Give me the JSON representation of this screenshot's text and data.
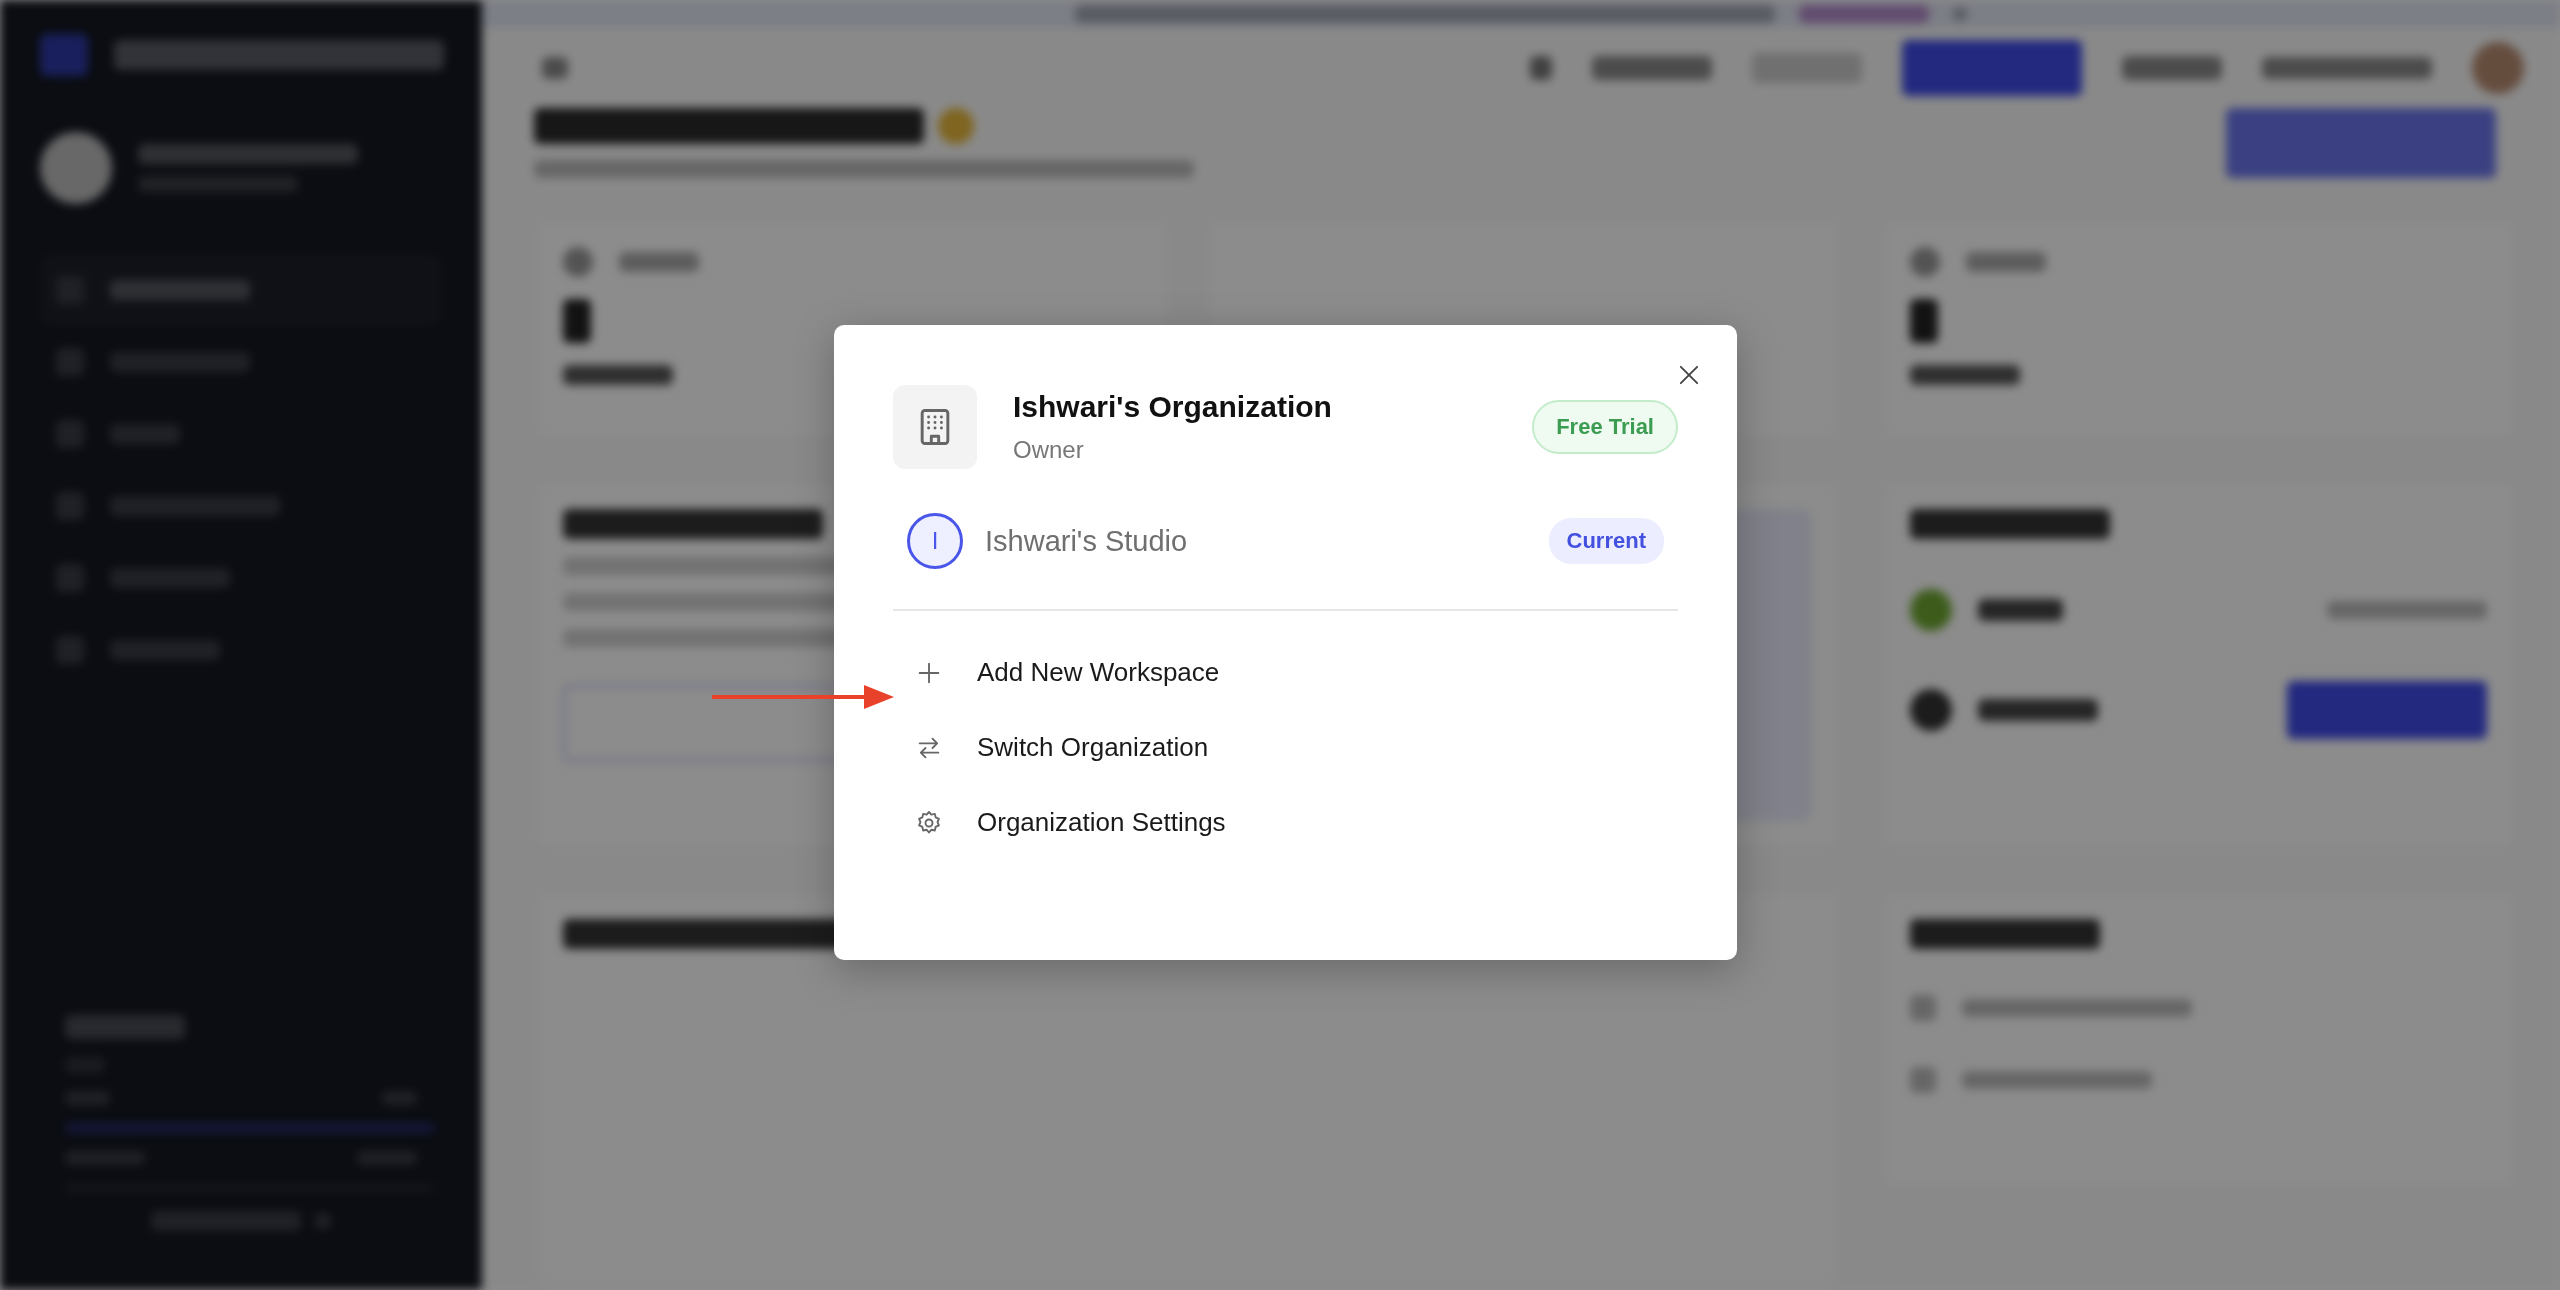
{
  "modal": {
    "org_name": "Ishwari's Organization",
    "role": "Owner",
    "plan_badge": "Free Trial",
    "workspaces": [
      {
        "initial": "I",
        "name": "Ishwari's Studio",
        "badge": "Current",
        "selected": true
      }
    ],
    "actions": [
      {
        "kind": "add",
        "label": "Add New Workspace"
      },
      {
        "kind": "switch",
        "label": "Switch Organization"
      },
      {
        "kind": "settings",
        "label": "Organization Settings"
      }
    ]
  }
}
